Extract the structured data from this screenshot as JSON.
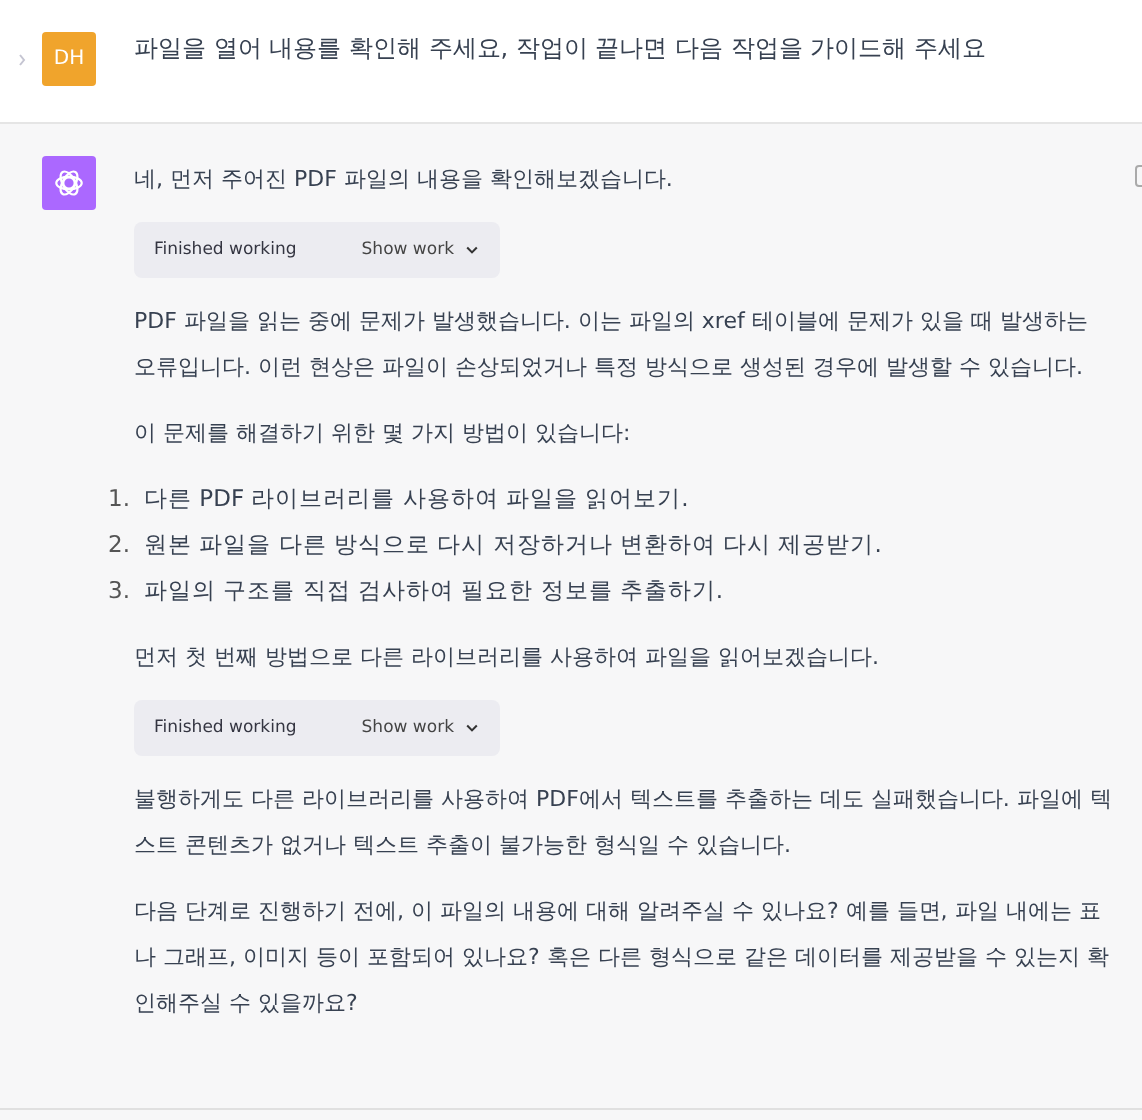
{
  "user_message": {
    "avatar": "DH",
    "text": "파일을 열어 내용를 확인해 주세요, 작업이 끝나면 다음 작업을 가이드해 주세요"
  },
  "assistant_message": {
    "blocks": [
      {
        "kind": "text",
        "text": "네, 먼저 주어진 PDF 파일의 내용을 확인해보겠습니다."
      },
      {
        "kind": "tool",
        "status": "Finished working",
        "action": "Show work",
        "expanded": false
      },
      {
        "kind": "text",
        "text": "PDF 파일을 읽는 중에 문제가 발생했습니다. 이는 파일의 xref 테이블에 문제가 있을 때 발생하는 오류입니다. 이런 현상은 파일이 손상되었거나 특정 방식으로 생성된 경우에 발생할 수 있습니다."
      },
      {
        "kind": "text",
        "text": "이 문제를 해결하기 위한 몇 가지 방법이 있습니다:"
      },
      {
        "kind": "list",
        "items": [
          {
            "number": "1.",
            "text": "다른 PDF 라이브러리를 사용하여 파일을 읽어보기."
          },
          {
            "number": "2.",
            "text": "원본 파일을 다른 방식으로 다시 저장하거나 변환하여 다시 제공받기."
          },
          {
            "number": "3.",
            "text": "파일의 구조를 직접 검사하여 필요한 정보를 추출하기."
          }
        ]
      },
      {
        "kind": "text",
        "text": "먼저 첫 번째 방법으로 다른 라이브러리를 사용하여 파일을 읽어보겠습니다."
      },
      {
        "kind": "tool",
        "status": "Finished working",
        "action": "Show work",
        "expanded": false
      },
      {
        "kind": "text",
        "text": "불행하게도 다른 라이브러리를 사용하여 PDF에서 텍스트를 추출하는 데도 실패했습니다. 파일에 텍스트 콘텐츠가 없거나 텍스트 추출이 불가능한 형식일 수 있습니다."
      },
      {
        "kind": "text",
        "text": "다음 단계로 진행하기 전에, 이 파일의 내용에 대해 알려주실 수 있나요? 예를 들면, 파일 내에는 표나 그래프, 이미지 등이 포함되어 있나요? 혹은 다른 형식으로 같은 데이터를 제공받을 수 있는지 확인해주실 수 있을까요?"
      }
    ]
  }
}
